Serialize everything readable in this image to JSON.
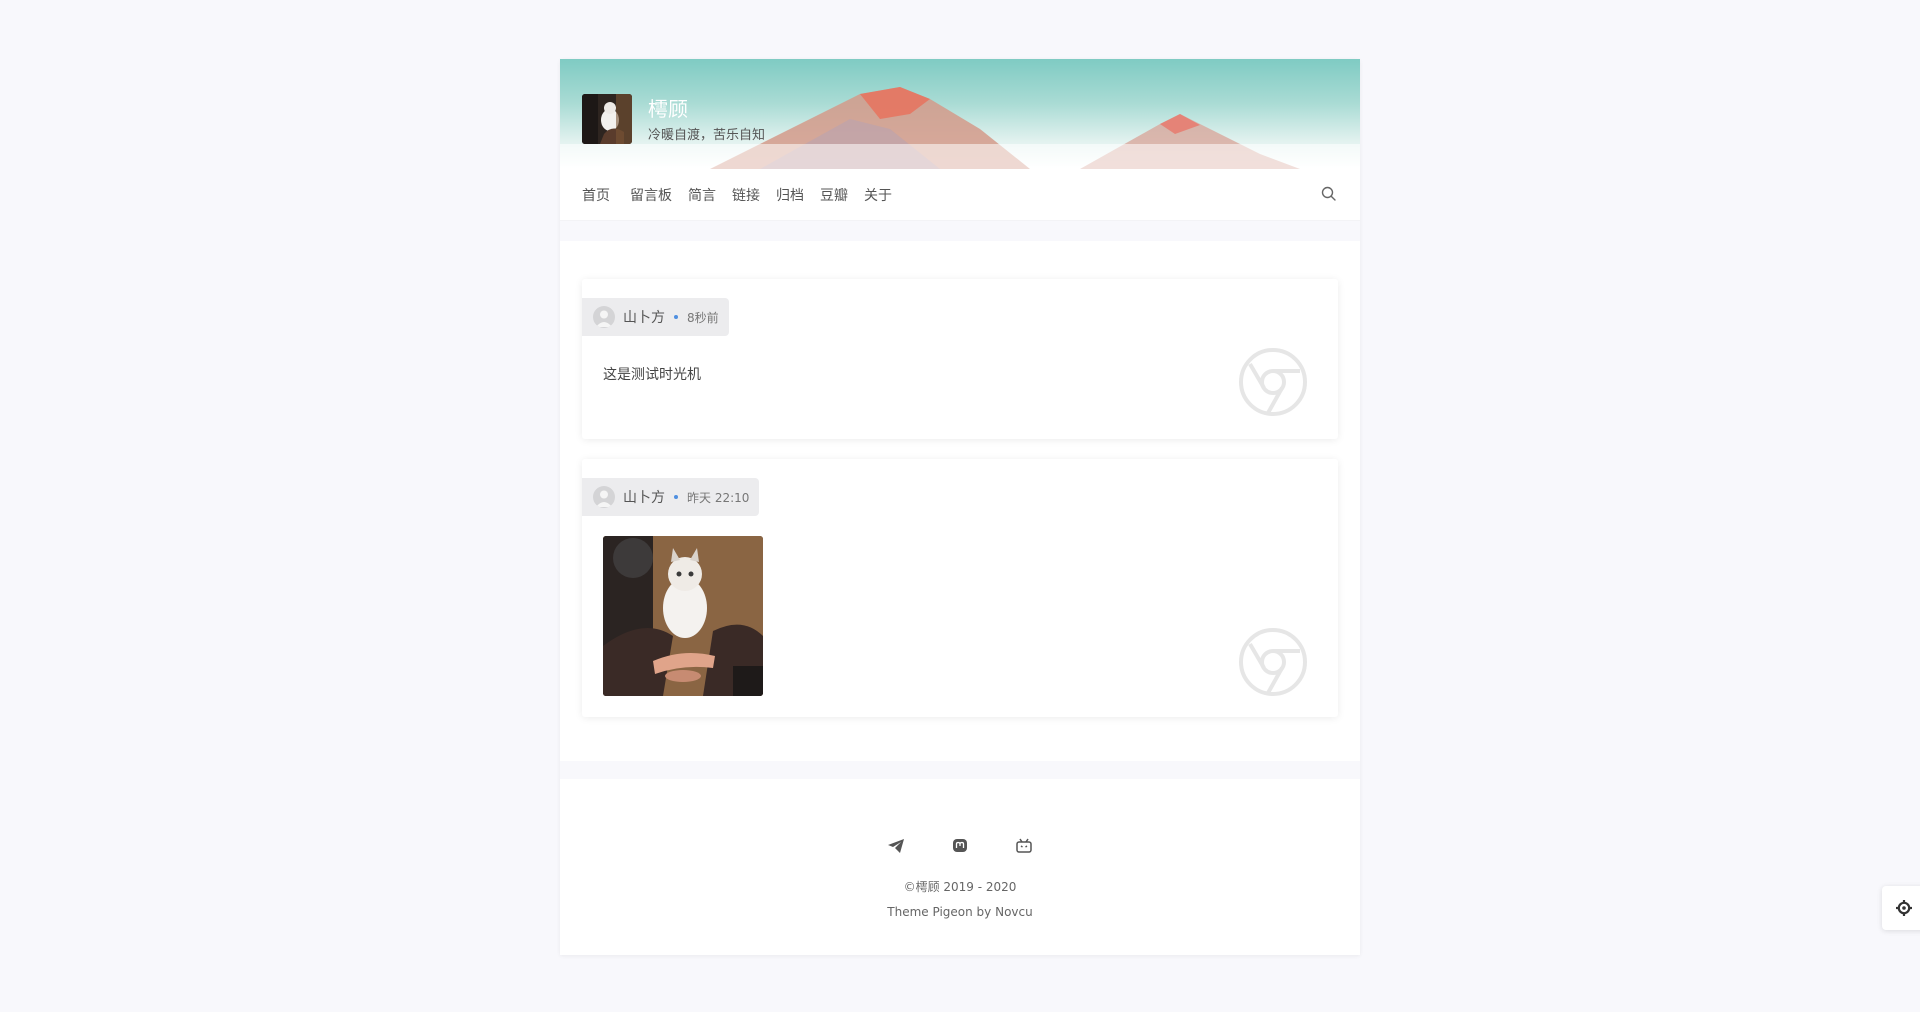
{
  "site": {
    "title": "樗顾",
    "subtitle": "冷暖自渡，苦乐自知"
  },
  "nav": {
    "items": [
      {
        "label": "首页"
      },
      {
        "label": "留言板"
      },
      {
        "label": "简言"
      },
      {
        "label": "链接"
      },
      {
        "label": "归档"
      },
      {
        "label": "豆瓣"
      },
      {
        "label": "关于"
      }
    ],
    "search_icon": "search-icon"
  },
  "posts": [
    {
      "author": "山卜方",
      "time": "8秒前",
      "text": "这是测试时光机",
      "has_image": false
    },
    {
      "author": "山卜方",
      "time": "昨天 22:10",
      "text": "",
      "has_image": true
    }
  ],
  "footer": {
    "social_icons": [
      "telegram-icon",
      "mastodon-icon",
      "bilibili-icon"
    ],
    "copyright": "©樗顾 2019 - 2020",
    "theme_line": "Theme Pigeon by Novcu"
  },
  "colors": {
    "accent_dot": "#4f8fe0",
    "header_teal": "#7fcbc3"
  }
}
